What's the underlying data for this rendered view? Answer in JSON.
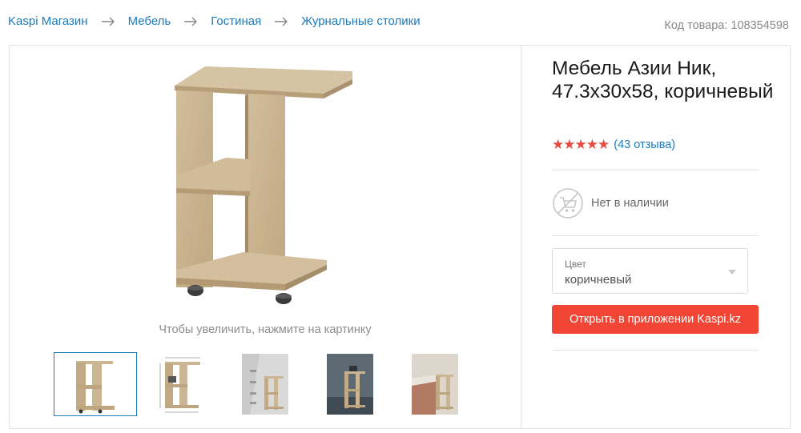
{
  "breadcrumbs": [
    {
      "label": "Kaspi Магазин"
    },
    {
      "label": "Мебель"
    },
    {
      "label": "Гостиная"
    },
    {
      "label": "Журнальные столики"
    }
  ],
  "sku_text": "Код товара: 108354598",
  "product": {
    "title": "Мебель Азии Ник, 47.3x30x58, коричневый",
    "rating": 5,
    "reviews_text": "(43 отзыва)",
    "availability": "Нет в наличии",
    "zoom_hint": "Чтобы увеличить, нажмите на картинку",
    "color_select": {
      "label": "Цвет",
      "value": "коричневый"
    },
    "open_app_button": "Открыть в приложении Kaspi.kz"
  },
  "thumbnails": [
    {
      "name": "thumbnail-1",
      "active": true
    },
    {
      "name": "thumbnail-2",
      "active": false
    },
    {
      "name": "thumbnail-3",
      "active": false
    },
    {
      "name": "thumbnail-4",
      "active": false
    },
    {
      "name": "thumbnail-5",
      "active": false
    }
  ],
  "colors": {
    "link": "#1b7bbd",
    "button": "#f14635",
    "star": "#e84a3f",
    "wood": "#cbb593"
  },
  "icons": {
    "breadcrumb_separator": "arrow-right-icon",
    "availability": "cart-crossed-icon",
    "select_caret": "caret-down-icon"
  }
}
